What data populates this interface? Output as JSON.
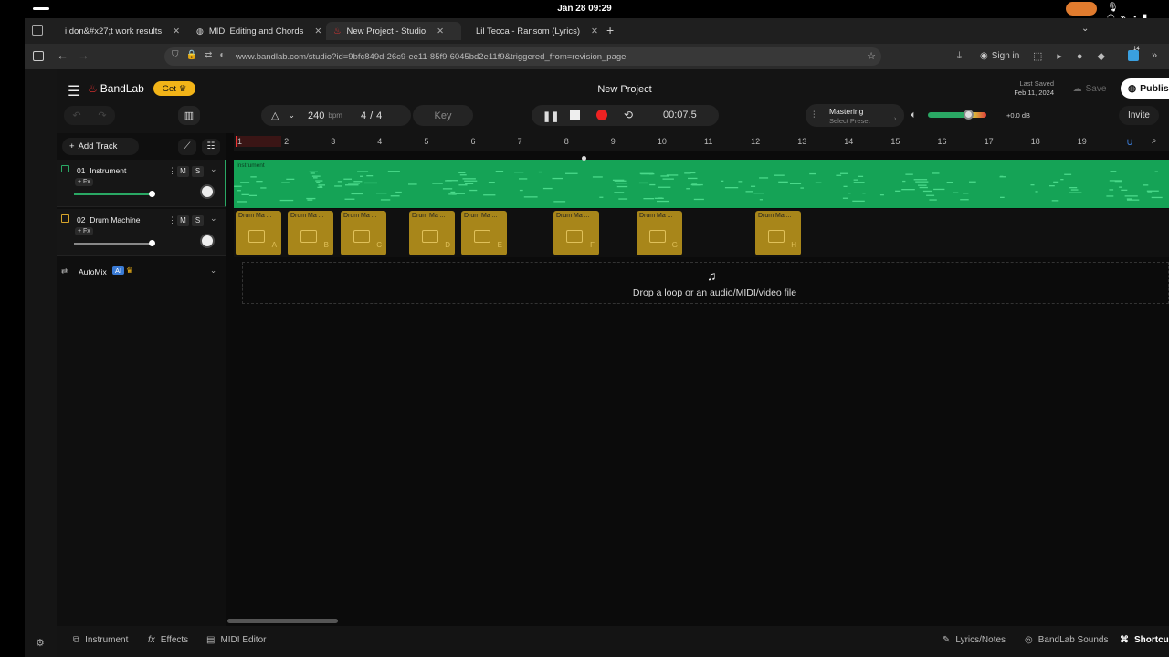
{
  "status": {
    "date_time": "Jan 28  09:29"
  },
  "tabs": [
    {
      "label": "i don&#x27;t work results",
      "icon": "youtube-icon"
    },
    {
      "label": "MIDI Editing and Chords",
      "icon": "globe-icon"
    },
    {
      "label": "New Project - Studio",
      "icon": "bandlab-icon"
    },
    {
      "label": "Lil Tecca - Ransom (Lyrics)",
      "icon": "youtube-icon"
    }
  ],
  "url": "www.bandlab.com/studio?id=9bfc849d-26c9-ee11-85f9-6045bd2e11f9&triggered_from=revision_page",
  "browser": {
    "sign_in": "Sign in",
    "badge": "14"
  },
  "app": {
    "brand": "BandLab",
    "get_label": "Get",
    "project_title": "New Project",
    "last_saved_label": "Last Saved",
    "last_saved_date": "Feb 11, 2024",
    "save": "Save",
    "publish": "Publis",
    "invite": "Invite"
  },
  "toolbar": {
    "tempo": "240",
    "tempo_unit": "bpm",
    "time_sig_num": "4",
    "time_sig_sep": "/",
    "time_sig_den": "4",
    "key": "Key",
    "time": "00:07.5",
    "mastering": "Mastering",
    "select_preset": "Select Preset",
    "gain": "+0.0 dB"
  },
  "tracks": [
    {
      "num": "01",
      "name": "Instrument",
      "fx": "+ Fx",
      "m": "M",
      "s": "S",
      "color": "#2aa864",
      "volume": 0.85
    },
    {
      "num": "02",
      "name": "Drum Machine",
      "fx": "+ Fx",
      "m": "M",
      "s": "S",
      "color": "#d6a42a",
      "volume": 0.85
    }
  ],
  "add_track": "Add Track",
  "automix": {
    "label": "AutoMix",
    "ai": "AI"
  },
  "ruler": [
    "1",
    "2",
    "3",
    "4",
    "5",
    "6",
    "7",
    "8",
    "9",
    "10",
    "11",
    "12",
    "13",
    "14",
    "15",
    "16",
    "17",
    "18",
    "19"
  ],
  "lane1_label": "Instrument",
  "clips": [
    {
      "name": "Drum Ma ...",
      "letter": "A"
    },
    {
      "name": "Drum Ma ...",
      "letter": "B"
    },
    {
      "name": "Drum Ma ...",
      "letter": "C"
    },
    {
      "name": "Drum Ma ...",
      "letter": "D"
    },
    {
      "name": "Drum Ma ...",
      "letter": "E"
    },
    {
      "name": "Drum Ma ...",
      "letter": "F"
    },
    {
      "name": "Drum Ma ...",
      "letter": "G"
    },
    {
      "name": "Drum Ma ...",
      "letter": "H"
    }
  ],
  "drop_text": "Drop a loop or an audio/MIDI/video file",
  "bottom": {
    "instrument": "Instrument",
    "effects": "Effects",
    "midi_editor": "MIDI Editor",
    "lyrics": "Lyrics/Notes",
    "sounds": "BandLab Sounds",
    "shortcuts": "Shortcu"
  }
}
